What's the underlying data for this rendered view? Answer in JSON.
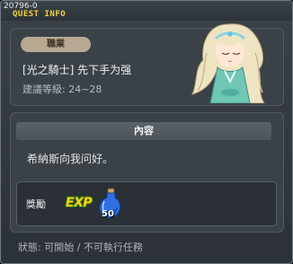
{
  "header": {
    "quest_id": "20796-0",
    "title": "QUEST INFO"
  },
  "quest": {
    "job_badge": "職業",
    "name": "[光之騎士] 先下手为强",
    "level": "建議等級: 24~28"
  },
  "content": {
    "section_title": "內容",
    "description": "希納斯向我问好。"
  },
  "reward": {
    "label": "獎勵",
    "exp_label": "EXP",
    "quantity": "50"
  },
  "status": {
    "text": "狀態: 可開始 / 不可執行任務"
  },
  "colors": {
    "title": "#f6d33c",
    "badge": "#b7a992",
    "panel": "#3b4247"
  },
  "icons": [
    "npc-portrait",
    "exp-icon",
    "potion-icon"
  ]
}
